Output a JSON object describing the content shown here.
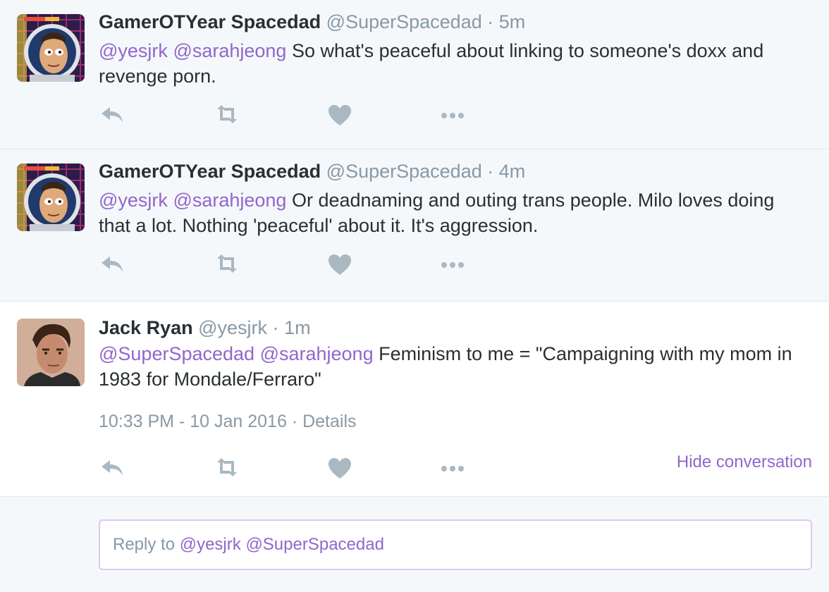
{
  "tweets": [
    {
      "name": "GamerOTYear Spacedad",
      "handle": "@SuperSpacedad",
      "sep": "·",
      "time": "5m",
      "mentions": [
        "@yesjrk",
        "@sarahjeong"
      ],
      "text": "So what's peaceful about linking to someone's doxx and revenge porn.",
      "avatar_icon": "astronaut-avatar"
    },
    {
      "name": "GamerOTYear Spacedad",
      "handle": "@SuperSpacedad",
      "sep": "·",
      "time": "4m",
      "mentions": [
        "@yesjrk",
        "@sarahjeong"
      ],
      "text": "Or deadnaming and outing trans people. Milo loves doing that a lot. Nothing 'peaceful' about it. It's aggression.",
      "avatar_icon": "astronaut-avatar"
    },
    {
      "name": "Jack Ryan",
      "handle": "@yesjrk",
      "sep": "·",
      "time": "1m",
      "mentions": [
        "@SuperSpacedad",
        "@sarahjeong"
      ],
      "text": "Feminism to me = \"Campaigning with my mom in 1983 for Mondale/Ferraro\"",
      "avatar_icon": "user-photo-avatar",
      "timestamp": "10:33 PM - 10 Jan 2016",
      "meta_sep": "·",
      "details_label": "Details",
      "hide_conversation_label": "Hide conversation"
    }
  ],
  "reply": {
    "prefix": "Reply to ",
    "mention1": "@yesjrk",
    "mention2": "@SuperSpacedad"
  },
  "colors": {
    "mention": "#9266cc",
    "icon": "#aab8c2",
    "muted": "#8899a6",
    "background": "#f5f8fa"
  }
}
